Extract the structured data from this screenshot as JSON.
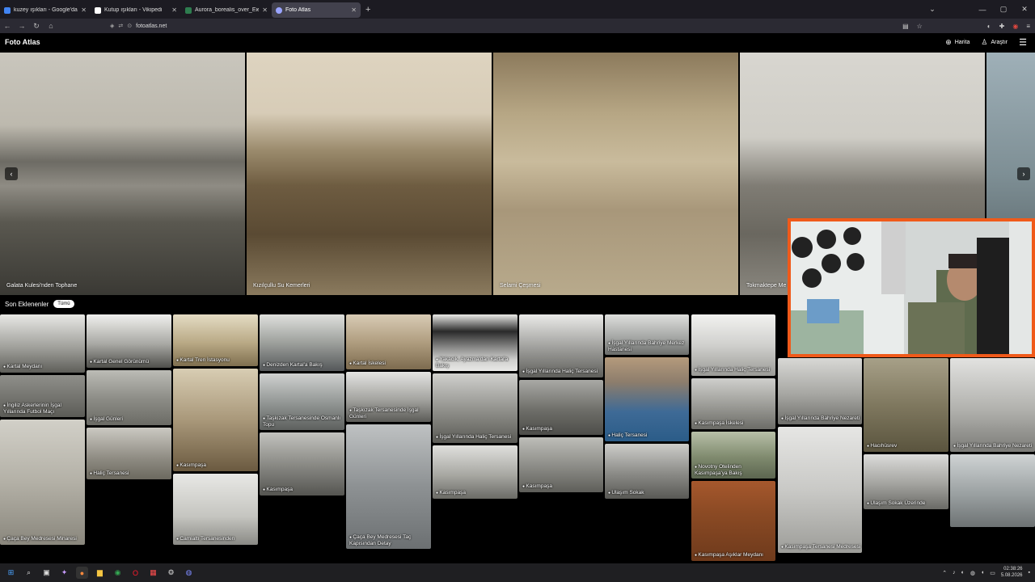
{
  "browser": {
    "tabs": [
      {
        "title": "kuzey ışıkları - Google'da Ara",
        "color": "#4285f4"
      },
      {
        "title": "Kutup ışıkları - Vikipedi",
        "color": "#ffffff"
      },
      {
        "title": "Aurora_borealis_over_Eielson_A",
        "color": "#2e7d4f"
      },
      {
        "title": "Foto Atlas",
        "color": "#9aa4ff"
      }
    ],
    "url": "fotoatlas.net"
  },
  "site": {
    "logo": "Foto Atlas",
    "nav_map": "Harita",
    "nav_explore": "Araştır"
  },
  "carousel": [
    {
      "caption": "Galata Kulesi'nden Tophane"
    },
    {
      "caption": "Kızılçullu Su Kemerleri"
    },
    {
      "caption": "Selami Çeşmesi"
    },
    {
      "caption": "Tokmaktepe Me"
    }
  ],
  "recent": {
    "title": "Son Eklenenler",
    "filter": "Tümü",
    "cards": [
      "Kartal Meydanı",
      "Kartal Genel Görünümü",
      "Kartal Tren İstasyonu",
      "Denizden Kartal'a Bakış",
      "Kartal İskelesi",
      "Yakacık, Ayazma'dan Kartal'a Bakış",
      "İşgal Yıllarında Haliç Tersanesi",
      "İşgal Yıllarında Bahriye Merkez Hastanesi",
      "İşgal Yıllarında Haliç Tersanesi",
      "İngiliz Askerlerinin İşgal Yıllarında Futbol Maçı",
      "İşgal Günleri",
      "Kasımpaşa",
      "Taşkızak Tersanesinde Osmanlı Topu",
      "Taşkızak Tersanesinde İşgal Günleri",
      "İşgal Yıllarında Haliç Tersanesi",
      "Kasımpaşa",
      "Haliç Tersanesi",
      "Kasımpaşa İskelesi",
      "İşgal Yıllarında Bahriye Nezareti",
      "Hacıhüsrev",
      "İşgal Yıllarında Bahriye Nezareti",
      "Çaça Bey Medresesi Minaresi",
      "Haliç Tersanesi",
      "Camialtı Tersanesinden",
      "Kasımpaşa",
      "Çaça Bey Medresesi Taç Kapısından Detay",
      "Kasımpaşa",
      "Kasımpaşa",
      "Ulaşım Sokak",
      "Novotny Otelinden Kasımpaşa'ya Bakış",
      "Kasımpaşa Aşıklar Meydanı",
      "Kasımpaşa Tersanesi Medresesi",
      "Ulaşım Sokak Üzerinde"
    ]
  },
  "taskbar": {
    "time": "02:38:26",
    "date": "5.08.2026"
  }
}
